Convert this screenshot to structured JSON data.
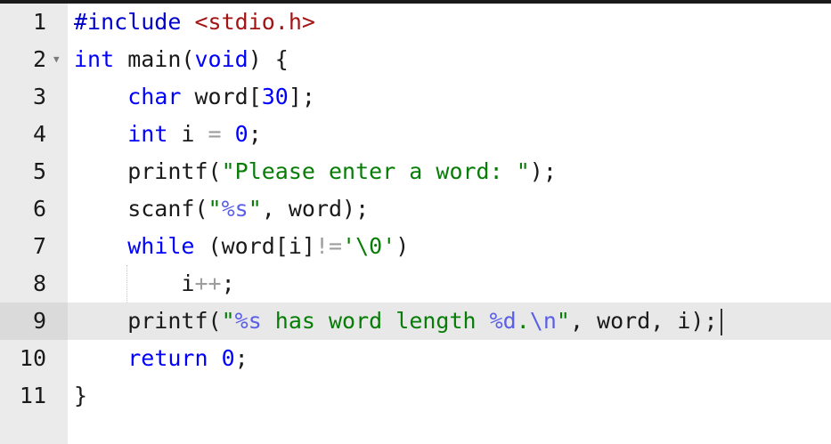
{
  "editor": {
    "language": "c",
    "active_line": 9,
    "folded_line": 2,
    "lines": [
      {
        "number": "1",
        "tokens": [
          "#include",
          " ",
          "<stdio.h>"
        ]
      },
      {
        "number": "2",
        "tokens": [
          "int",
          " main(",
          "void",
          ") {"
        ]
      },
      {
        "number": "3",
        "tokens": [
          "    ",
          "char",
          " word[",
          "30",
          "];"
        ]
      },
      {
        "number": "4",
        "tokens": [
          "    ",
          "int",
          " i ",
          "=",
          " ",
          "0",
          ";"
        ]
      },
      {
        "number": "5",
        "tokens": [
          "    printf(",
          "\"Please enter a word: \"",
          ");"
        ]
      },
      {
        "number": "6",
        "tokens": [
          "    scanf(",
          "\"",
          "%s",
          "\"",
          ", word);"
        ]
      },
      {
        "number": "7",
        "tokens": [
          "    ",
          "while",
          " (word[i]",
          "!=",
          "'\\0'",
          ")"
        ]
      },
      {
        "number": "8",
        "tokens": [
          "        i",
          "++",
          ";"
        ]
      },
      {
        "number": "9",
        "tokens": [
          "    printf(",
          "\"",
          "%s",
          " has word length ",
          "%d",
          ".",
          "\\n",
          "\"",
          ", word, i);"
        ]
      },
      {
        "number": "10",
        "tokens": [
          "    ",
          "return",
          " ",
          "0",
          ";"
        ]
      },
      {
        "number": "11",
        "tokens": [
          "}"
        ]
      }
    ]
  },
  "icons": {
    "fold": "chevron-down-icon"
  },
  "colors": {
    "keyword": "#0000ff",
    "include_path": "#a31515",
    "string": "#077d07",
    "format_specifier": "#5a5fe8",
    "operator": "#9e9e9e",
    "gutter": "#ebebeb",
    "active_line": "#e8e8e8"
  }
}
